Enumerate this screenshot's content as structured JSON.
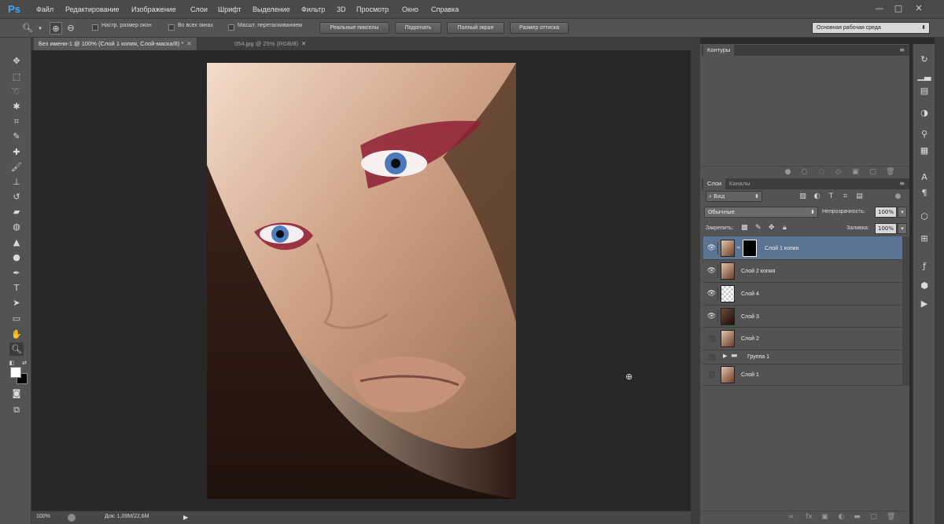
{
  "app": {
    "logo": "Ps"
  },
  "menu": [
    "Файл",
    "Редактирование",
    "Изображение",
    "Слои",
    "Шрифт",
    "Выделение",
    "Фильтр",
    "3D",
    "Просмотр",
    "Окно",
    "Справка"
  ],
  "window_controls": {
    "minimize": "—",
    "maximize": "□",
    "close": "✕"
  },
  "options": {
    "checks": [
      "Настр. размер окон",
      "Во всех окнах",
      "Масшт. перетаскиванием"
    ],
    "buttons": [
      "Реальные пикселы",
      "Подогнать",
      "Полный экран",
      "Размер оттиска"
    ],
    "workspace": "Основная рабочая среда"
  },
  "doc_tabs": [
    {
      "label": "Без имени-1 @ 100% (Слой 1 копия, Слой-маска/8) *",
      "active": true
    },
    {
      "label": "054.jpg @ 25% (RGB/8)",
      "active": false
    }
  ],
  "status": {
    "zoom": "100%",
    "doc": "Док: 1,09M/22,6M"
  },
  "panels": {
    "paths_tab": "Контуры",
    "layers_tab": "Слои",
    "channels_tab": "Каналы",
    "kind": "Вид",
    "blend_mode": "Обычные",
    "opacity_label": "Непрозрачность:",
    "opacity_value": "100%",
    "lock_label": "Закрепить:",
    "fill_label": "Заливка:",
    "fill_value": "100%"
  },
  "layers": [
    {
      "name": "Слой 1 копия",
      "visible": true,
      "selected": true,
      "has_mask": true,
      "thumb": "portrait"
    },
    {
      "name": "Слой 2 копия",
      "visible": true,
      "selected": false,
      "has_mask": false,
      "thumb": "portrait"
    },
    {
      "name": "Слой 4",
      "visible": true,
      "selected": false,
      "has_mask": false,
      "thumb": "transparent"
    },
    {
      "name": "Слой 3",
      "visible": true,
      "selected": false,
      "has_mask": false,
      "thumb": "dark"
    },
    {
      "name": "Слой 2",
      "visible": false,
      "selected": false,
      "has_mask": false,
      "thumb": "portrait"
    },
    {
      "name": "Группа 1",
      "visible": false,
      "selected": false,
      "group": true
    },
    {
      "name": "Слой 1",
      "visible": false,
      "selected": false,
      "has_mask": false,
      "thumb": "portrait"
    }
  ],
  "colors": {
    "selected_layer": "#5b7493",
    "foreground": "#ffffff",
    "background": "#000000"
  }
}
